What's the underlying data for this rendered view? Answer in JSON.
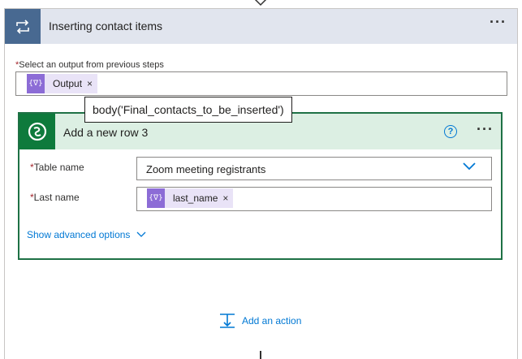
{
  "loop": {
    "title": "Inserting contact items",
    "output_label_required": "*",
    "output_label": "Select an output from previous steps",
    "output_token": {
      "icon_text": "{∇}",
      "label": "Output",
      "remove": "×"
    },
    "more_icon": "more-options-icon"
  },
  "tooltip": {
    "text": "body('Final_contacts_to_be_inserted')"
  },
  "action": {
    "title": "Add a new row 3",
    "help_glyph": "?",
    "fields": {
      "table_name": {
        "required": "*",
        "label": "Table name",
        "value": "Zoom meeting registrants"
      },
      "last_name": {
        "required": "*",
        "label": "Last name",
        "token": {
          "icon_text": "{∇}",
          "label": "last_name",
          "remove": "×"
        }
      }
    },
    "advanced_label": "Show advanced options"
  },
  "add_action": {
    "label": "Add an action"
  },
  "colors": {
    "loop_icon_bg": "#486991",
    "loop_header_bg": "#e1e5ee",
    "action_accent": "#0e7a3c",
    "action_header_bg": "#dcefe3",
    "token_bg": "#e9e3f7",
    "token_icon_bg": "#8c6cd6",
    "link": "#0078d4",
    "required": "#a4262c"
  }
}
